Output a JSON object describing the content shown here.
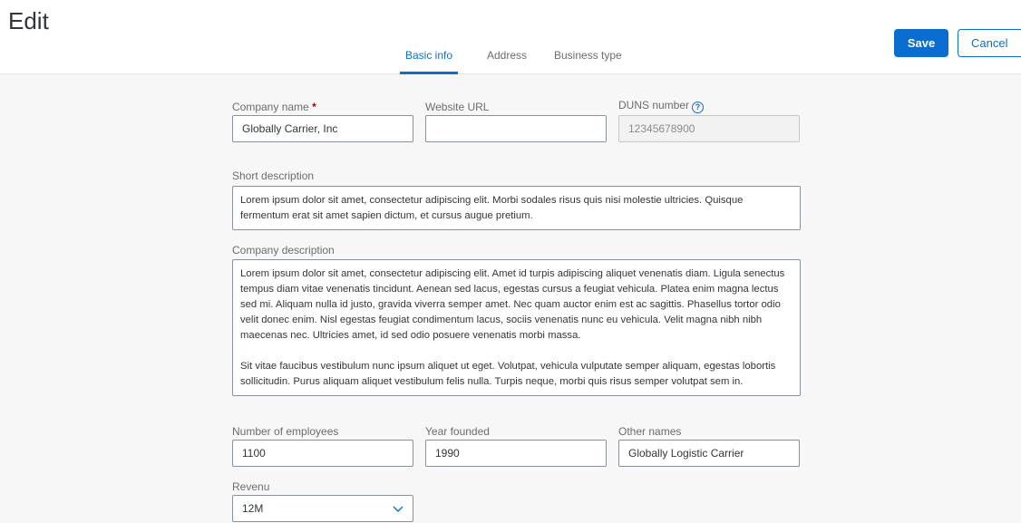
{
  "page": {
    "title": "Edit"
  },
  "tabs": [
    {
      "label": "Basic info"
    },
    {
      "label": "Address"
    },
    {
      "label": "Business type"
    }
  ],
  "actions": {
    "save_label": "Save",
    "cancel_label": "Cancel"
  },
  "form": {
    "company_name": {
      "label": "Company name",
      "required_mark": "*",
      "value": "Globally Carrier, Inc"
    },
    "website_url": {
      "label": "Website URL",
      "value": ""
    },
    "duns_number": {
      "label": "DUNS number",
      "help_glyph": "?",
      "value": "12345678900"
    },
    "short_description": {
      "label": "Short description",
      "value": "Lorem ipsum dolor sit amet, consectetur adipiscing elit. Morbi sodales risus quis nisi molestie ultricies. Quisque fermentum erat sit amet sapien dictum, et cursus augue pretium."
    },
    "company_description": {
      "label": "Company description",
      "paragraphs": [
        "Lorem ipsum dolor sit amet, consectetur adipiscing elit. Amet id turpis adipiscing aliquet venenatis diam. Ligula senectus tempus diam vitae venenatis tincidunt. Aenean sed lacus, egestas cursus a feugiat vehicula. Platea enim magna lectus sed mi. Aliquam nulla id justo, gravida viverra semper amet. Nec quam auctor enim est ac sagittis. Phasellus tortor odio velit donec enim. Nisl egestas feugiat condimentum lacus, sociis venenatis nunc eu vehicula. Velit magna nibh nibh maecenas nec. Ultricies amet, id sed odio posuere venenatis morbi massa.",
        "Sit vitae faucibus vestibulum nunc ipsum aliquet ut eget. Volutpat, vehicula vulputate semper aliquam, egestas lobortis sollicitudin. Purus aliquam aliquet vestibulum felis nulla. Turpis neque, morbi quis risus semper volutpat sem in."
      ]
    },
    "number_of_employees": {
      "label": "Number of employees",
      "value": "1100"
    },
    "year_founded": {
      "label": "Year founded",
      "value": "1990"
    },
    "other_names": {
      "label": "Other names",
      "value": "Globally Logistic Carrier"
    },
    "revenue": {
      "label": "Revenu",
      "value": "12M"
    }
  },
  "colors": {
    "accent": "#0a6ed1",
    "required": "#bb0000",
    "border": "#89919a"
  },
  "icons": {
    "duns_help": "help-circle-icon",
    "revenue_dropdown": "chevron-down-icon"
  }
}
